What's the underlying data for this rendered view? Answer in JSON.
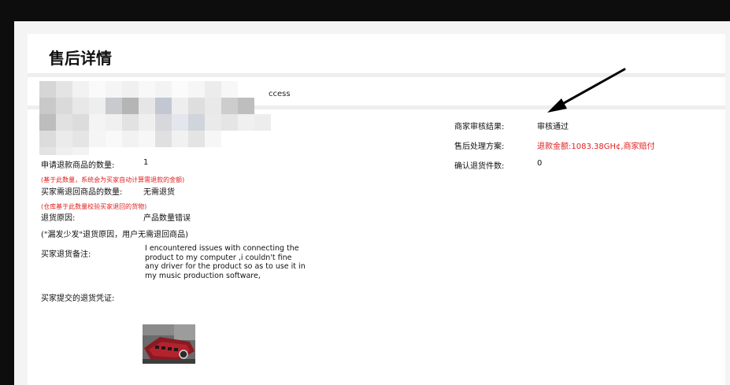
{
  "page": {
    "title": "售后详情",
    "status_text": "ccess"
  },
  "left": {
    "qty_label": "申请退款商品的数量:",
    "qty_value": "1",
    "qty_note": "(基于此数量，系统会为买家自动计算需退款的金额)",
    "return_qty_label": "买家需退回商品的数量:",
    "return_qty_value": "无需退货",
    "return_qty_note": "(仓库基于此数量校验买家退回的货物)",
    "reason_label": "退货原因:",
    "reason_value": "产品数量错误",
    "reason_note": "(\"漏发少发\"退货原因，用户无需退回商品)",
    "comment_label": "买家退货备注:",
    "comment_value": "I encountered issues with connecting the product to my computer ,i couldn't fine any driver for the product so as to use it in my music production software,",
    "evidence_label": "买家提交的退货凭证:"
  },
  "right": {
    "review_result_label": "商家审核结果:",
    "review_result_value": "审核通过",
    "solution_label": "售后处理方案:",
    "solution_value": "退款金额:1083.38GH¢,商家赔付",
    "confirm_label": "确认退货件数:",
    "confirm_value": "0"
  },
  "colors": {
    "accent_red": "#e02020",
    "background": "#0d0d0d",
    "panel": "#ffffff",
    "divider": "#eeeeee"
  },
  "icons": {
    "annotation": "arrow-icon"
  }
}
